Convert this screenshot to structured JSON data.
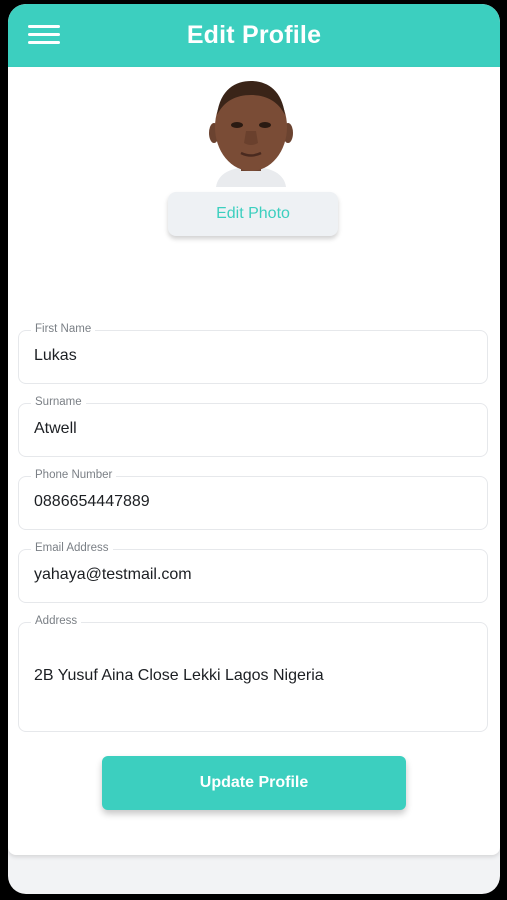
{
  "header": {
    "title": "Edit Profile",
    "menu_icon": "hamburger-menu-icon",
    "background_color": "#3ccfbf"
  },
  "profile": {
    "edit_photo_label": "Edit Photo"
  },
  "form": {
    "first_name": {
      "label": "First Name",
      "value": "Lukas"
    },
    "surname": {
      "label": "Surname",
      "value": "Atwell"
    },
    "phone": {
      "label": "Phone Number",
      "value": "0886654447889"
    },
    "email": {
      "label": "Email Address",
      "value": "yahaya@testmail.com"
    },
    "address": {
      "label": "Address",
      "value": "2B Yusuf Aina Close Lekki Lagos Nigeria"
    }
  },
  "actions": {
    "update_label": "Update Profile"
  },
  "colors": {
    "accent": "#3ccfbf",
    "text": "#1c1f23",
    "label": "#7a7f85"
  }
}
